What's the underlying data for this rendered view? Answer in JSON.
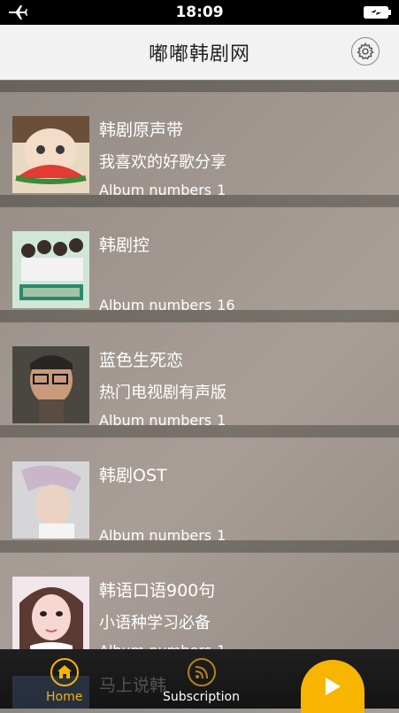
{
  "statusbar": {
    "time": "18:09"
  },
  "header": {
    "title": "嘟嘟韩剧网",
    "settings_icon": "gear-icon"
  },
  "items": [
    {
      "title": "韩剧原声带",
      "subtitle": "我喜欢的好歌分享",
      "count_label": "Album numbers",
      "count": "1"
    },
    {
      "title": "韩剧控",
      "subtitle": "",
      "count_label": "Album numbers",
      "count": "16"
    },
    {
      "title": "蓝色生死恋",
      "subtitle": "热门电视剧有声版",
      "count_label": "Album numbers",
      "count": "1"
    },
    {
      "title": "韩剧OST",
      "subtitle": "",
      "count_label": "Album numbers",
      "count": "1"
    },
    {
      "title": "韩语口语900句",
      "subtitle": "小语种学习必备",
      "count_label": "Album numbers",
      "count": "1"
    }
  ],
  "peek_item": {
    "title": "马上说韩"
  },
  "tabs": {
    "home": "Home",
    "subscription": "Subscription"
  },
  "colors": {
    "accent": "#f7b500",
    "tab_inactive": "#ffffff"
  }
}
